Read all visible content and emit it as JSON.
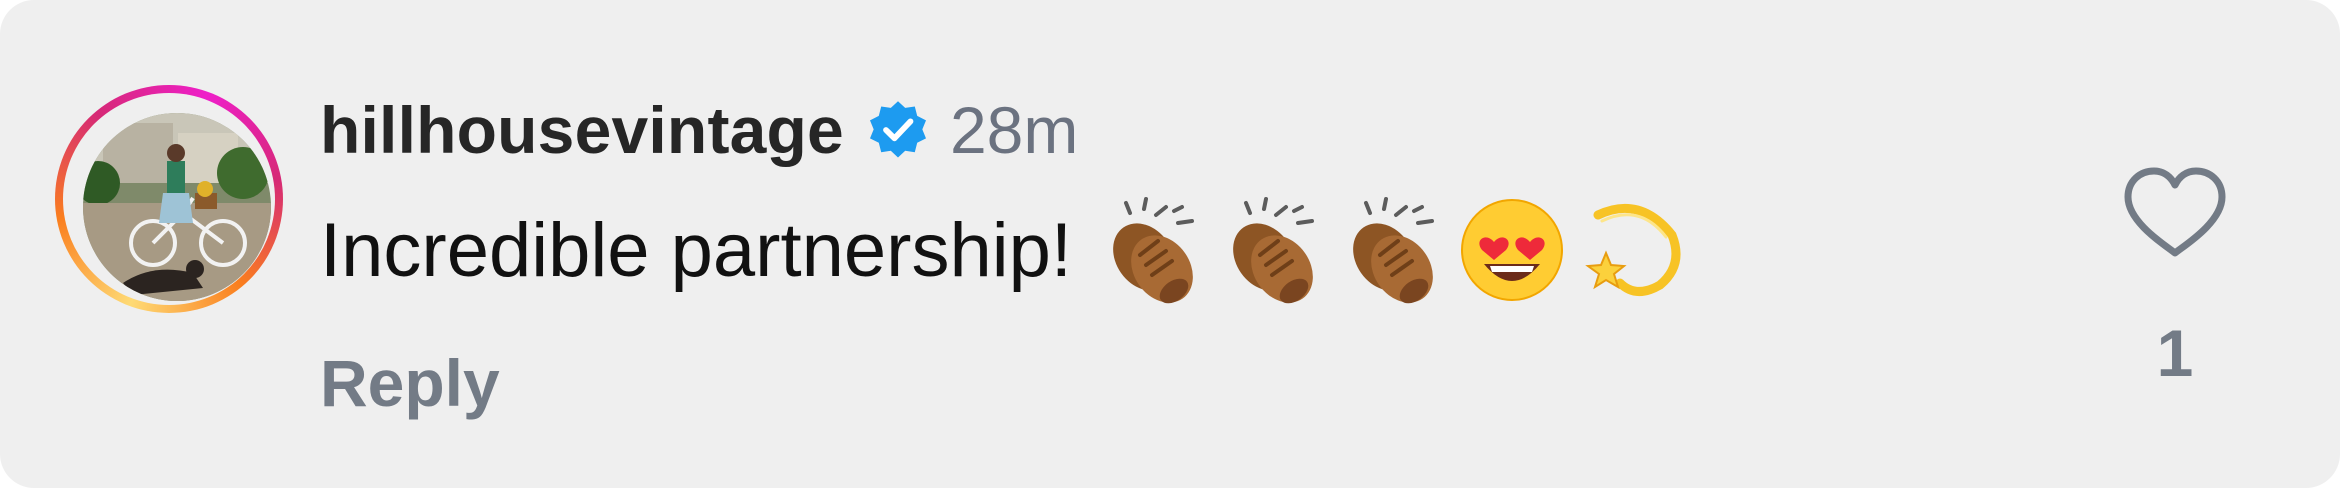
{
  "comment": {
    "username": "hillhousevintage",
    "verified": true,
    "timestamp": "28m",
    "text": "Incredible partnership!",
    "emojis": [
      "clapping-hands",
      "clapping-hands",
      "clapping-hands",
      "heart-eyes-face",
      "dizzy-star"
    ],
    "reply_label": "Reply",
    "like_count": "1"
  },
  "icons": {
    "verified": "verified-badge-icon",
    "like": "heart-outline-icon"
  },
  "colors": {
    "card_background": "#efefef",
    "username": "#262626",
    "secondary_text": "#737b86",
    "verified_badge": "#1d9bf0",
    "story_ring": [
      "#feda75",
      "#fa7e1e",
      "#d62976",
      "#ee1fc9"
    ]
  }
}
